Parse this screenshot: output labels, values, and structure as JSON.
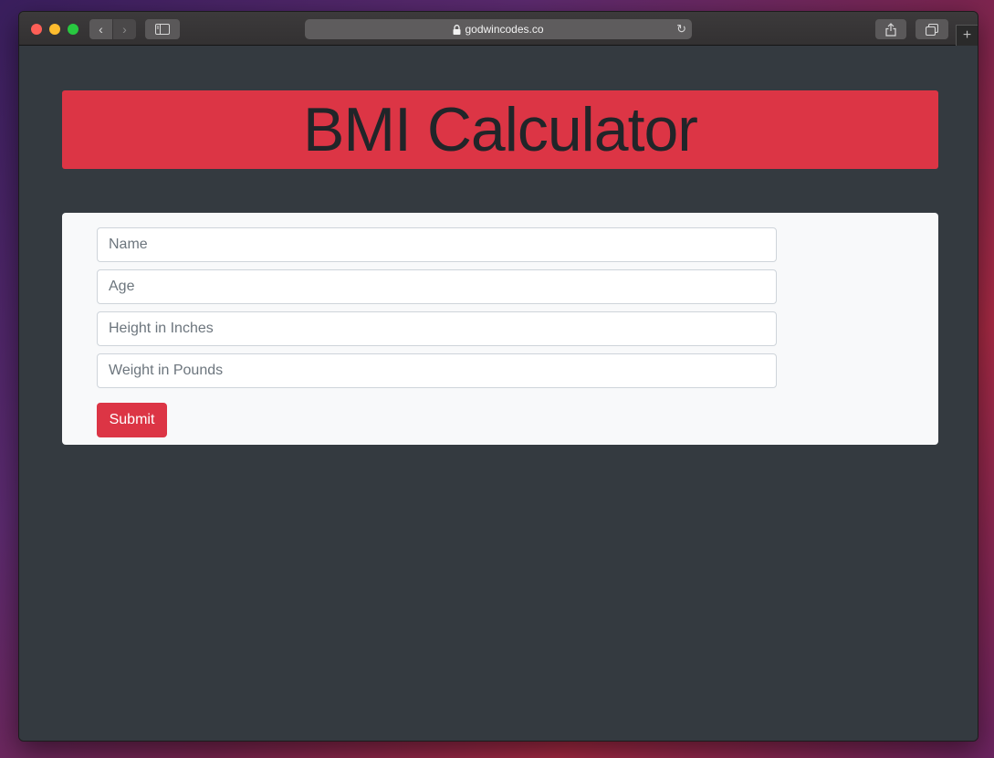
{
  "browser": {
    "url": "godwincodes.co",
    "back_glyph": "‹",
    "forward_glyph": "›",
    "newtab_glyph": "+",
    "reload_glyph": "↻"
  },
  "page": {
    "title": "BMI Calculator",
    "accent_color": "#dc3545",
    "background_color": "#343a40"
  },
  "form": {
    "name_placeholder": "Name",
    "age_placeholder": "Age",
    "height_placeholder": "Height in Inches",
    "weight_placeholder": "Weight in Pounds",
    "submit_label": "Submit"
  }
}
